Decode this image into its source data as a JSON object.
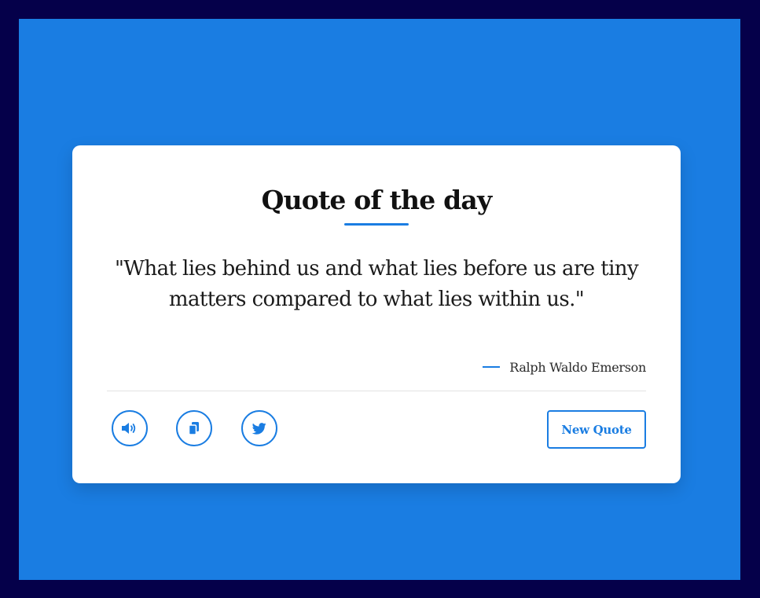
{
  "card": {
    "title": "Quote of the day",
    "quote": "\"What lies behind us and what lies before us are tiny matters compared to what lies within us.\"",
    "author": "Ralph Waldo Emerson"
  },
  "actions": {
    "speech_icon": "volume-icon",
    "copy_icon": "copy-icon",
    "twitter_icon": "twitter-icon",
    "new_quote_label": "New Quote"
  },
  "colors": {
    "background": "#1a7de2",
    "frame": "#05004a",
    "accent": "#1a7de2",
    "card": "#ffffff"
  }
}
